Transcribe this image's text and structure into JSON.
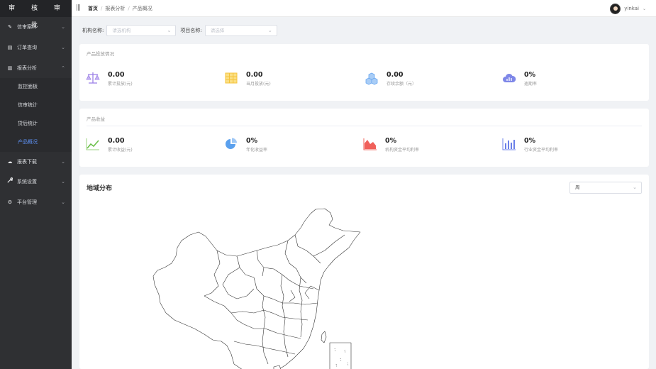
{
  "brand": "审 核 审 批",
  "sidebar": {
    "items": [
      {
        "label": "信审案件",
        "icon": "edit-icon",
        "glyph": "✎",
        "chevron": "⌄"
      },
      {
        "label": "订单查询",
        "icon": "card-icon",
        "glyph": "▤",
        "chevron": "⌄"
      },
      {
        "label": "报表分析",
        "icon": "bar-chart-icon",
        "glyph": "▥",
        "chevron": "⌃"
      }
    ],
    "submenu": [
      {
        "label": "监控面板",
        "active": false
      },
      {
        "label": "信审统计",
        "active": false
      },
      {
        "label": "贷后统计",
        "active": false
      },
      {
        "label": "产品概况",
        "active": true
      }
    ],
    "items_bottom": [
      {
        "label": "报表下载",
        "icon": "cloud-download-icon",
        "glyph": "☁",
        "chevron": "⌄"
      },
      {
        "label": "系统设置",
        "icon": "wrench-icon",
        "glyph": "✗",
        "chevron": "⌄"
      },
      {
        "label": "平台管理",
        "icon": "gear-icon",
        "glyph": "⚙",
        "chevron": "⌄"
      }
    ]
  },
  "header": {
    "hamburger": "|||",
    "breadcrumb": [
      "首页",
      "报表分析",
      "产品概况"
    ],
    "username": "yinkai",
    "caret": "⌄"
  },
  "filters": {
    "org_label": "机构名称:",
    "org_placeholder": "请选机构",
    "project_label": "项目名称:",
    "project_placeholder": "请选择",
    "caret": "⌄"
  },
  "investment": {
    "title": "产品投放情况",
    "stats": [
      {
        "value": "0.00",
        "label": "累计投放(元)",
        "icon": "scale-icon"
      },
      {
        "value": "0.00",
        "label": "当月投放(元)",
        "icon": "table-icon"
      },
      {
        "value": "0.00",
        "label": "存续余额（元）",
        "icon": "boxes-icon"
      },
      {
        "value": "0%",
        "label": "逾期率",
        "icon": "cloud-chart-icon"
      }
    ]
  },
  "revenue": {
    "title": "产品收益",
    "stats": [
      {
        "value": "0.00",
        "label": "累计收益(元)",
        "icon": "line-trend-icon"
      },
      {
        "value": "0%",
        "label": "年化收益率",
        "icon": "pie-icon"
      },
      {
        "value": "0%",
        "label": "机构资金平均利率",
        "icon": "area-chart-icon"
      },
      {
        "value": "0%",
        "label": "行业资金平均利率",
        "icon": "bar-chart-icon"
      }
    ]
  },
  "map": {
    "title": "地域分布",
    "period": "周",
    "caret": "⌄"
  },
  "colors": {
    "sidebar_bg": "#2f3033",
    "active": "#5c8ff0",
    "scale": "#9b7fe6",
    "table": "#f5c33b",
    "boxes": "#6aa8f0",
    "cloud": "#7e87e8",
    "trend": "#6cc04a",
    "pie": "#5aa0ee",
    "area": "#f0605a",
    "bars": "#6b80e8"
  }
}
